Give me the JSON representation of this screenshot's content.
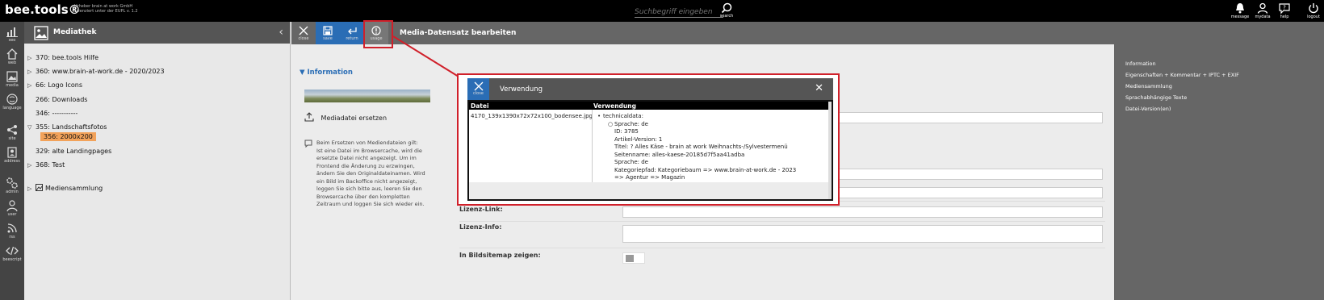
{
  "topbar": {
    "logo": "bee.tools®",
    "license_line1": "Urheber brain at work GmbH",
    "license_line2": "Lizenziert unter der EUPL v. 1.2",
    "search_placeholder": "Suchbegriff eingeben",
    "search_label": "search",
    "icons": [
      {
        "name": "message",
        "label": "message"
      },
      {
        "name": "mydata",
        "label": "mydata"
      },
      {
        "name": "help",
        "label": "help"
      },
      {
        "name": "logout",
        "label": "logout"
      }
    ]
  },
  "leftnav": [
    {
      "icon": "seo-icon",
      "label": "seo"
    },
    {
      "icon": "web-icon",
      "label": "web"
    },
    {
      "icon": "media-icon",
      "label": "media"
    },
    {
      "icon": "language-icon",
      "label": "language"
    },
    {
      "icon": "site-icon",
      "label": "site"
    },
    {
      "icon": "address-icon",
      "label": "address"
    },
    {
      "icon": "admin-icon",
      "label": "admin"
    },
    {
      "icon": "user-icon",
      "label": "user"
    },
    {
      "icon": "rss-icon",
      "label": "rss"
    },
    {
      "icon": "beescript-icon",
      "label": "beescript"
    }
  ],
  "mediapanel": {
    "title": "Mediathek",
    "tree": [
      {
        "label": "370: bee.tools Hilfe",
        "arrow": "▷",
        "indent": 0
      },
      {
        "label": "360: www.brain-at-work.de - 2020/2023",
        "arrow": "▷",
        "indent": 0
      },
      {
        "label": "66: Logo Icons",
        "arrow": "▷",
        "indent": 0
      },
      {
        "label": "266: Downloads",
        "arrow": "",
        "indent": 0
      },
      {
        "label": "346: -----------",
        "arrow": "",
        "indent": 0
      },
      {
        "label": "355: Landschaftsfotos",
        "arrow": "▽",
        "indent": 0
      },
      {
        "label": "356: 2000x200",
        "arrow": "",
        "indent": 1,
        "selected": true
      },
      {
        "label": "329: alte Landingpages",
        "arrow": "",
        "indent": 0
      },
      {
        "label": "368: Test",
        "arrow": "▷",
        "indent": 0
      },
      {
        "label": "Mediensammlung",
        "arrow": "▷",
        "indent": 0,
        "icon": true
      }
    ]
  },
  "toolbar": {
    "buttons": [
      {
        "label": "close"
      },
      {
        "label": "save"
      },
      {
        "label": "return"
      },
      {
        "label": "usage"
      }
    ],
    "title": "Media-Datensatz bearbeiten"
  },
  "content": {
    "info_heading": "Information",
    "replace_label": "Mediadatei ersetzen",
    "hint": "Beim Ersetzen von Mediendateien gilt: Ist eine Datei im Browsercache, wird die ersetzte Datei nicht angezeigt. Um im Frontend die Änderung zu erzwingen, ändern Sie den Originaldateinamen. Wird ein Bild im Backoffice nicht angezeigt, loggen Sie sich bitte aus, leeren Sie den Browsercache über den kompletten Zeitraum und loggen Sie sich wieder ein.",
    "field_lizenz_link": "Lizenz-Link:",
    "field_lizenz_info": "Lizenz-Info:",
    "field_bildsitemap": "In Bildsitemap zeigen:"
  },
  "rightbar": [
    "Information",
    "Eigenschaften + Kommentar + IPTC + EXIF",
    "Mediensammlung",
    "Sprachabhängige Texte",
    "Datei-Version(en)"
  ],
  "dialog": {
    "close_label": "close",
    "title": "Verwendung",
    "col_datei": "Datei",
    "col_verwendung": "Verwendung",
    "filename": "4170_139x1390x72x72x100_bodensee.jpg",
    "section": "technicaldata:",
    "details": [
      "Sprache: de",
      "ID: 3785",
      "Artikel-Version: 1",
      "Titel: ? Alles Käse - brain at work Weihnachts-/Sylvestermenü",
      "Seitenname: alles-kaese-20185d7f5aa41adba",
      "Sprache: de",
      "Kategoriepfad: Kategoriebaum => www.brain-at-work.de - 2023",
      "=> Agentur => Magazin"
    ]
  },
  "colors": {
    "accent_blue": "#2a6db5",
    "highlight_red": "#d0202a",
    "selected_orange": "#f2a25a"
  }
}
